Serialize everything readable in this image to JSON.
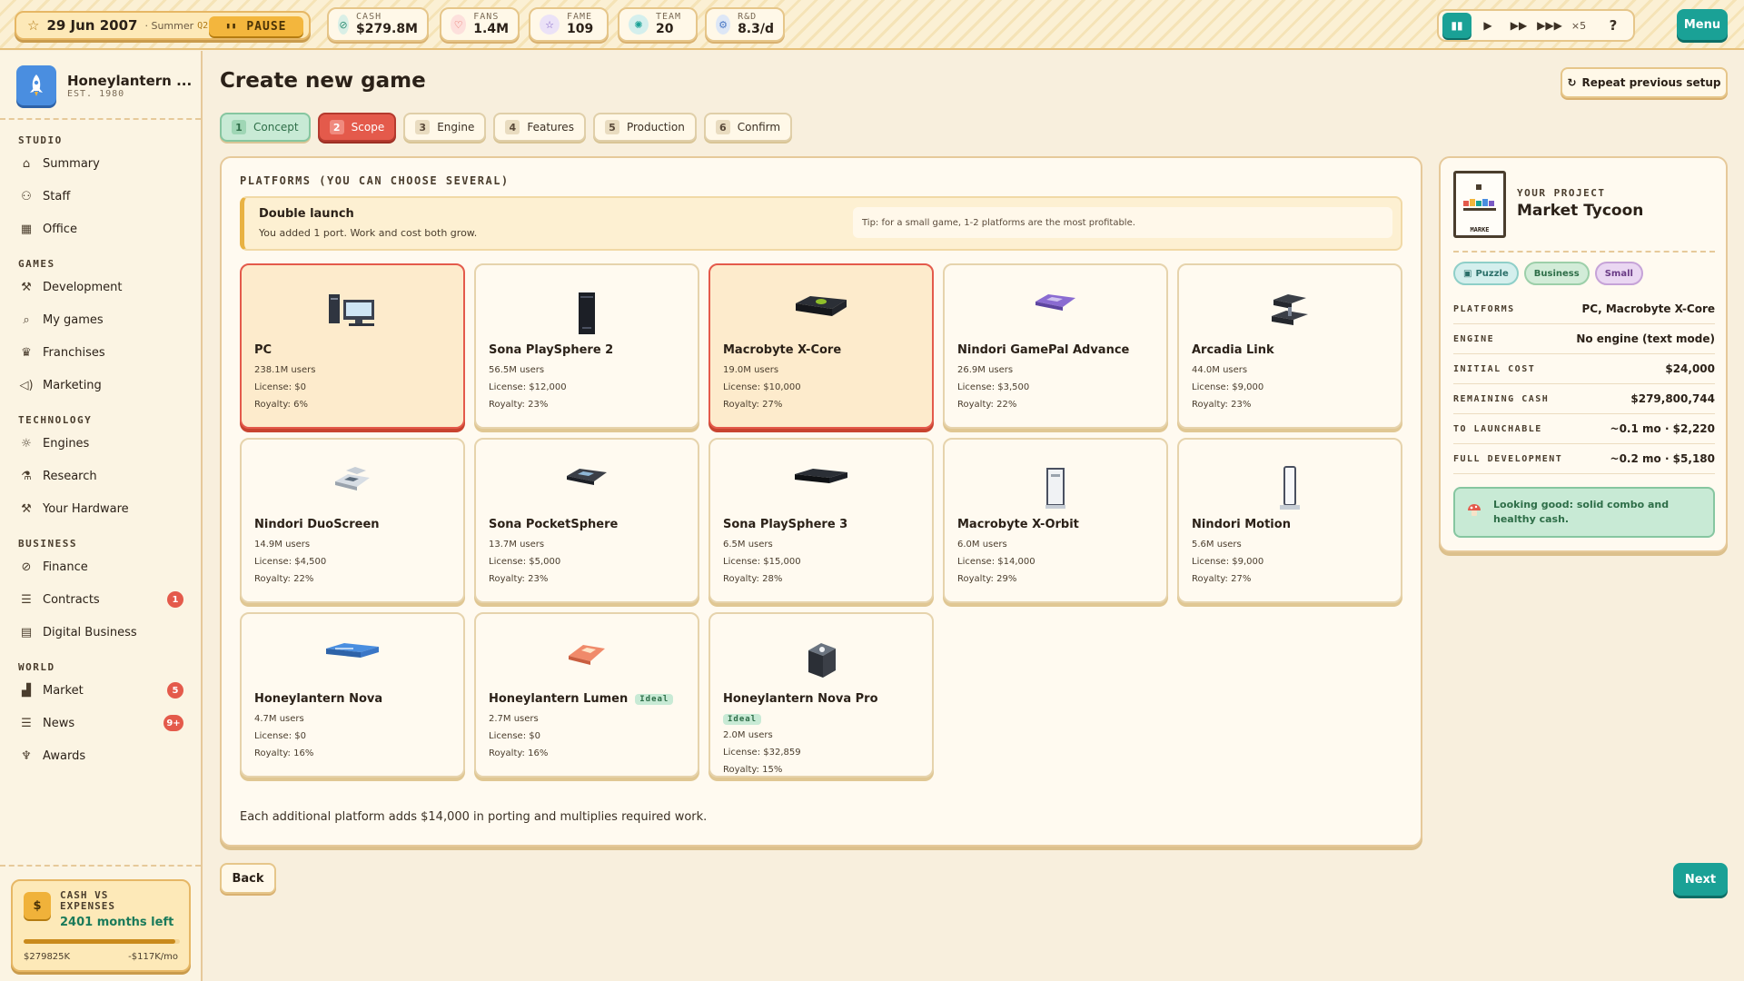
{
  "topbar": {
    "date": "29 Jun 2007",
    "season": "· Summer",
    "quarter": "Q2",
    "pause_label": "PAUSE",
    "stats": [
      {
        "label": "CASH",
        "value": "$279.8M",
        "icon": "coin-icon",
        "color": "#7fc4b0"
      },
      {
        "label": "FANS",
        "value": "1.4M",
        "icon": "heart-icon",
        "color": "#e45a4b"
      },
      {
        "label": "FAME",
        "value": "109",
        "icon": "star-icon",
        "color": "#7a5ac4"
      },
      {
        "label": "TEAM",
        "value": "20",
        "icon": "team-icon",
        "color": "#1aa196"
      },
      {
        "label": "R&D",
        "value": "8.3/d",
        "icon": "gear-icon",
        "color": "#4a78c4"
      }
    ],
    "speed_multiplier": "×5",
    "help_label": "?",
    "menu_label": "Menu"
  },
  "sidebar": {
    "studio_name": "Honeylantern ...",
    "studio_est": "EST. 1980",
    "sections": [
      {
        "title": "STUDIO",
        "items": [
          {
            "label": "Summary",
            "icon": "home-icon"
          },
          {
            "label": "Staff",
            "icon": "people-icon"
          },
          {
            "label": "Office",
            "icon": "building-icon"
          }
        ]
      },
      {
        "title": "GAMES",
        "items": [
          {
            "label": "Development",
            "icon": "hammer-icon"
          },
          {
            "label": "My games",
            "icon": "magnifier-icon"
          },
          {
            "label": "Franchises",
            "icon": "crown-icon"
          },
          {
            "label": "Marketing",
            "icon": "megaphone-icon"
          }
        ]
      },
      {
        "title": "TECHNOLOGY",
        "items": [
          {
            "label": "Engines",
            "icon": "sun-gear-icon"
          },
          {
            "label": "Research",
            "icon": "flask-icon"
          },
          {
            "label": "Your Hardware",
            "icon": "hammer-icon"
          }
        ]
      },
      {
        "title": "BUSINESS",
        "items": [
          {
            "label": "Finance",
            "icon": "coin-icon"
          },
          {
            "label": "Contracts",
            "icon": "document-icon",
            "badge": "1"
          },
          {
            "label": "Digital Business",
            "icon": "store-icon"
          }
        ]
      },
      {
        "title": "WORLD",
        "items": [
          {
            "label": "Market",
            "icon": "bar-chart-icon",
            "badge": "5"
          },
          {
            "label": "News",
            "icon": "newspaper-icon",
            "badge": "9+"
          },
          {
            "label": "Awards",
            "icon": "trophy-icon"
          }
        ]
      }
    ],
    "cash": {
      "title_line1": "CASH VS",
      "title_line2": "EXPENSES",
      "months_left": "2401 months left",
      "left_value": "$279825K",
      "right_value": "-$117K/mo",
      "progress": 0.97
    }
  },
  "main": {
    "title": "Create new game",
    "repeat_label": "Repeat previous setup",
    "steps": [
      {
        "n": "1",
        "label": "Concept",
        "state": "done"
      },
      {
        "n": "2",
        "label": "Scope",
        "state": "current"
      },
      {
        "n": "3",
        "label": "Engine",
        "state": "todo"
      },
      {
        "n": "4",
        "label": "Features",
        "state": "todo"
      },
      {
        "n": "5",
        "label": "Production",
        "state": "todo"
      },
      {
        "n": "6",
        "label": "Confirm",
        "state": "todo"
      }
    ],
    "platforms_label": "PLATFORMS (YOU CAN CHOOSE SEVERAL)",
    "alert": {
      "title": "Double launch",
      "body": "You added 1 port. Work and cost both grow.",
      "tip": "Tip: for a small game, 1-2 platforms are the most profitable."
    },
    "platforms": [
      {
        "name": "PC",
        "users": "238.1M users",
        "license": "License: $0",
        "royalty": "Royalty: 6%",
        "selected": true,
        "ideal": "",
        "art": "pc"
      },
      {
        "name": "Sona PlaySphere 2",
        "users": "56.5M users",
        "license": "License: $12,000",
        "royalty": "Royalty: 23%",
        "selected": false,
        "ideal": "",
        "art": "tower"
      },
      {
        "name": "Macrobyte X-Core",
        "users": "19.0M users",
        "license": "License: $10,000",
        "royalty": "Royalty: 27%",
        "selected": true,
        "ideal": "",
        "art": "xcore"
      },
      {
        "name": "Nindori GamePal Advance",
        "users": "26.9M users",
        "license": "License: $3,500",
        "royalty": "Royalty: 22%",
        "selected": false,
        "ideal": "",
        "art": "handheld-purple"
      },
      {
        "name": "Arcadia Link",
        "users": "44.0M users",
        "license": "License: $9,000",
        "royalty": "Royalty: 23%",
        "selected": false,
        "ideal": "",
        "art": "link"
      },
      {
        "name": "Nindori DuoScreen",
        "users": "14.9M users",
        "license": "License: $4,500",
        "royalty": "Royalty: 22%",
        "selected": false,
        "ideal": "",
        "art": "ds"
      },
      {
        "name": "Sona PocketSphere",
        "users": "13.7M users",
        "license": "License: $5,000",
        "royalty": "Royalty: 23%",
        "selected": false,
        "ideal": "",
        "art": "psp"
      },
      {
        "name": "Sona PlaySphere 3",
        "users": "6.5M users",
        "license": "License: $15,000",
        "royalty": "Royalty: 28%",
        "selected": false,
        "ideal": "",
        "art": "ps3"
      },
      {
        "name": "Macrobyte X-Orbit",
        "users": "6.0M users",
        "license": "License: $14,000",
        "royalty": "Royalty: 29%",
        "selected": false,
        "ideal": "",
        "art": "xorbit"
      },
      {
        "name": "Nindori Motion",
        "users": "5.6M users",
        "license": "License: $9,000",
        "royalty": "Royalty: 27%",
        "selected": false,
        "ideal": "",
        "art": "wii"
      },
      {
        "name": "Honeylantern Nova",
        "users": "4.7M users",
        "license": "License: $0",
        "royalty": "Royalty: 16%",
        "selected": false,
        "ideal": "",
        "art": "nova"
      },
      {
        "name": "Honeylantern Lumen",
        "users": "2.7M users",
        "license": "License: $0",
        "royalty": "Royalty: 16%",
        "selected": false,
        "ideal": "Ideal",
        "art": "lumen"
      },
      {
        "name": "Honeylantern Nova Pro",
        "users": "2.0M users",
        "license": "License: $32,859",
        "royalty": "Royalty: 15%",
        "selected": false,
        "ideal": "Ideal",
        "art": "novapro"
      }
    ],
    "note": "Each additional platform adds $14,000 in porting and multiplies required work.",
    "back_label": "Back",
    "next_label": "Next"
  },
  "project": {
    "label": "YOUR PROJECT",
    "name": "Market Tycoon",
    "cover_text": "MARKE",
    "tags": [
      {
        "label": "Puzzle",
        "style": "teal"
      },
      {
        "label": "Business",
        "style": "green"
      },
      {
        "label": "Small",
        "style": "purple"
      }
    ],
    "rows": [
      {
        "k": "PLATFORMS",
        "v": "PC, Macrobyte X-Core"
      },
      {
        "k": "ENGINE",
        "v": "No engine (text mode)"
      },
      {
        "k": "INITIAL COST",
        "v": "$24,000"
      },
      {
        "k": "REMAINING CASH",
        "v": "$279,800,744"
      },
      {
        "k": "TO LAUNCHABLE",
        "v": "~0.1 mo · $2,220"
      },
      {
        "k": "FULL DEVELOPMENT",
        "v": "~0.2 mo · $5,180"
      }
    ],
    "status": "Looking good: solid combo and healthy cash."
  }
}
